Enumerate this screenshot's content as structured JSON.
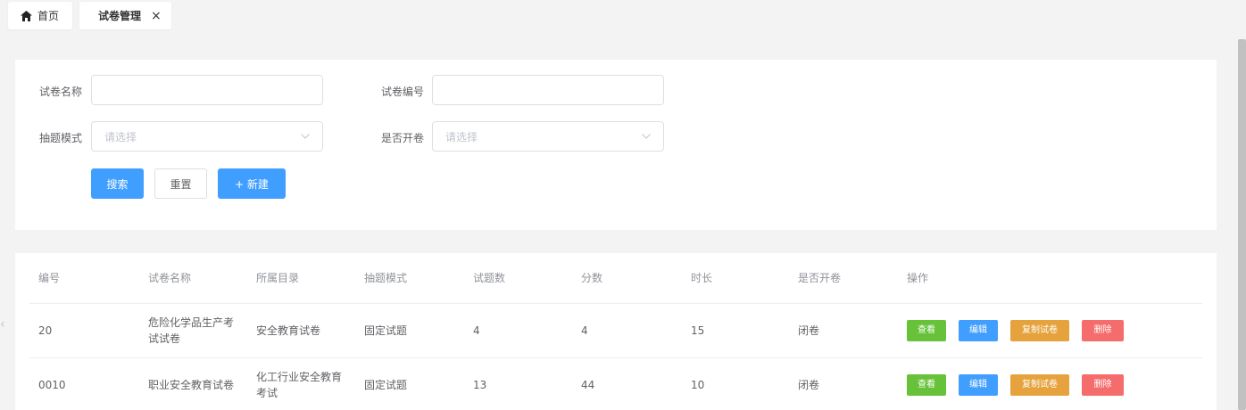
{
  "tabs": [
    {
      "label": "首页",
      "icon": "home-icon"
    },
    {
      "label": "试卷管理",
      "close": "×"
    }
  ],
  "search": {
    "name_label": "试卷名称",
    "name_value": "",
    "code_label": "试卷编号",
    "code_value": "",
    "mode_label": "抽题模式",
    "mode_placeholder": "请选择",
    "open_label": "是否开卷",
    "open_placeholder": "请选择",
    "search_btn": "搜索",
    "reset_btn": "重置",
    "new_btn": "+ 新建"
  },
  "table": {
    "headers": [
      "编号",
      "试卷名称",
      "所属目录",
      "抽题模式",
      "试题数",
      "分数",
      "时长",
      "是否开卷",
      "操作"
    ],
    "rows": [
      {
        "id": "20",
        "name": "危险化学品生产考试试卷",
        "catalog": "安全教育试卷",
        "mode": "固定试题",
        "count": "4",
        "score": "4",
        "duration": "15",
        "open": "闭卷"
      },
      {
        "id": "0010",
        "name": "职业安全教育试卷",
        "catalog": "化工行业安全教育考试",
        "mode": "固定试题",
        "count": "13",
        "score": "44",
        "duration": "10",
        "open": "闭卷"
      }
    ],
    "actions": {
      "view": "查看",
      "edit": "编辑",
      "copy": "复制试卷",
      "delete": "删除"
    }
  },
  "colors": {
    "primary": "#409eff",
    "success": "#67c23a",
    "warning": "#e6a23c",
    "danger": "#f56c6c"
  }
}
